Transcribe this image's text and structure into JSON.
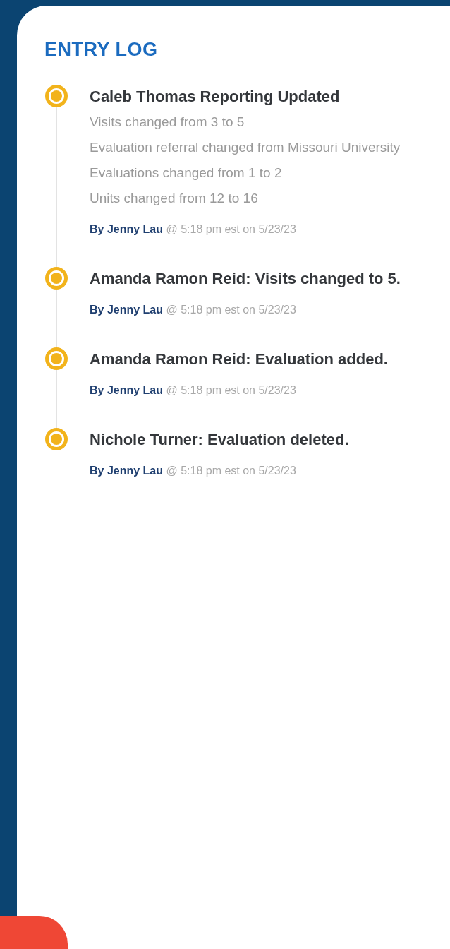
{
  "header": {
    "title": "ENTRY LOG"
  },
  "entries": [
    {
      "title": "Caleb Thomas Reporting Updated",
      "details": [
        "Visits changed from 3 to 5",
        "Evaluation referral changed from Missouri University",
        "Evaluations changed from 1 to 2",
        "Units changed from 12 to 16"
      ],
      "author": "By Jenny Lau",
      "meta": "@ 5:18 pm est on 5/23/23"
    },
    {
      "title": "Amanda Ramon Reid: Visits changed to 5.",
      "author": "By Jenny Lau",
      "meta": "@ 5:18 pm est on 5/23/23"
    },
    {
      "title": "Amanda Ramon Reid: Evaluation added.",
      "author": "By Jenny Lau",
      "meta": "@ 5:18 pm est on 5/23/23"
    },
    {
      "title": "Nichole Turner: Evaluation deleted.",
      "author": "By Jenny Lau",
      "meta": "@ 5:18 pm est on 5/23/23"
    }
  ]
}
